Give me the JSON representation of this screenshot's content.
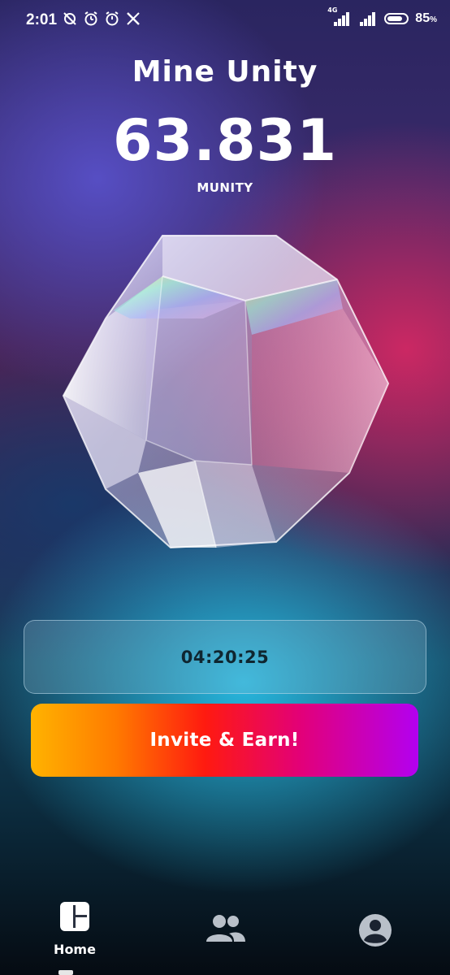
{
  "status_bar": {
    "time": "2:01",
    "network_label": "4G",
    "battery_percent": "85",
    "battery_unit": "%",
    "left_icons": [
      "no-sync-icon",
      "alarm-icon",
      "alarm-icon",
      "x-icon"
    ]
  },
  "header": {
    "title": "Mine Unity",
    "balance": "63.831",
    "unit": "MUNITY"
  },
  "timer": {
    "value": "04:20:25"
  },
  "invite_button": {
    "label": "Invite & Earn!"
  },
  "bottom_nav": {
    "items": [
      {
        "label": "Home",
        "icon": "dashboard-icon",
        "active": true
      },
      {
        "label": "",
        "icon": "people-icon",
        "active": false
      },
      {
        "label": "",
        "icon": "account-circle-icon",
        "active": false
      }
    ]
  },
  "colors": {
    "accent_gradient": [
      "#ffb300",
      "#ff1a10",
      "#b300f0"
    ],
    "text": "#ffffff",
    "timer_text": "#0f2630"
  }
}
